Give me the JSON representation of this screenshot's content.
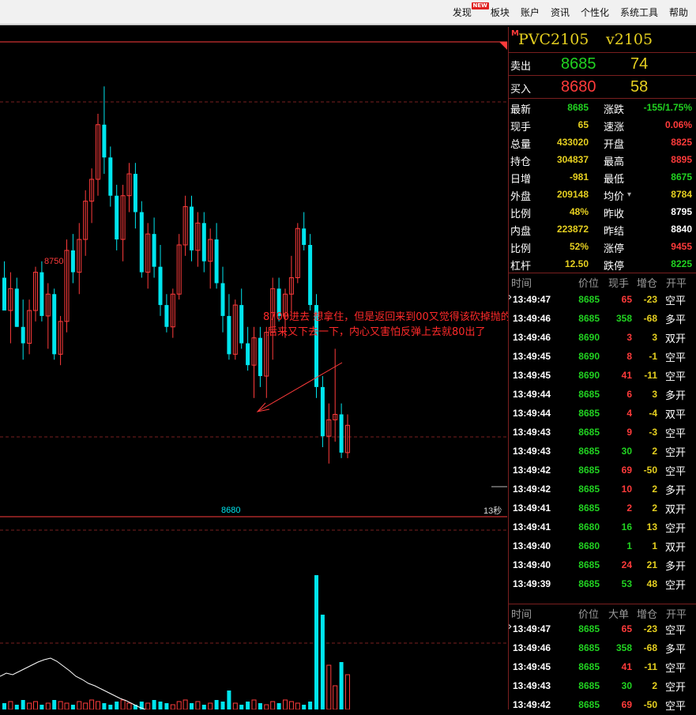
{
  "menu": [
    {
      "label": "发现",
      "badge": "NEW"
    },
    {
      "label": "板块"
    },
    {
      "label": "账户"
    },
    {
      "label": "资讯"
    },
    {
      "label": "个性化"
    },
    {
      "label": "系统工具"
    },
    {
      "label": "帮助"
    }
  ],
  "colors": {
    "up": "#ff3b3b",
    "down": "#00e5ee",
    "green": "#21d321",
    "yellow": "#e6d020",
    "white": "#ffffff",
    "grid": "#7a1f1f"
  },
  "chart": {
    "high_label": "8750",
    "low_label": "8680",
    "countdown": "13秒",
    "annotation_line1": "8700进去 想拿住，但是返回来到00又觉得该砍掉抛的",
    "annotation_line2": "后来又下去一下，内心又害怕反弹上去就80出了"
  },
  "header": {
    "marker": "M",
    "symbol": "PVC2105",
    "name": "v2105"
  },
  "order_book": {
    "ask": {
      "label": "卖出",
      "price": "8685",
      "volume": "74"
    },
    "bid": {
      "label": "买入",
      "price": "8680",
      "volume": "58"
    }
  },
  "quote_stats": [
    {
      "l1": "最新",
      "v1": "8685",
      "c1": "green",
      "l2": "涨跌",
      "v2": "-155/1.75%",
      "c2": "green"
    },
    {
      "l1": "现手",
      "v1": "65",
      "c1": "yellow",
      "l2": "速涨",
      "v2": "0.06%",
      "c2": "red"
    },
    {
      "l1": "总量",
      "v1": "433020",
      "c1": "yellow",
      "l2": "开盘",
      "v2": "8825",
      "c2": "red"
    },
    {
      "l1": "持仓",
      "v1": "304837",
      "c1": "yellow",
      "l2": "最高",
      "v2": "8895",
      "c2": "red"
    },
    {
      "l1": "日增",
      "v1": "-981",
      "c1": "yellow",
      "l2": "最低",
      "v2": "8675",
      "c2": "green"
    },
    {
      "l1": "外盘",
      "v1": "209148",
      "c1": "yellow",
      "l2": "均价",
      "v2": "8784",
      "c2": "yellow",
      "arrow": "▾"
    },
    {
      "l1": "比例",
      "v1": "48%",
      "c1": "yellow",
      "l2": "昨收",
      "v2": "8795",
      "c2": "white"
    },
    {
      "l1": "内盘",
      "v1": "223872",
      "c1": "yellow",
      "l2": "昨结",
      "v2": "8840",
      "c2": "white"
    },
    {
      "l1": "比例",
      "v1": "52%",
      "c1": "yellow",
      "l2": "涨停",
      "v2": "9455",
      "c2": "red"
    },
    {
      "l1": "杠杆",
      "v1": "12.50",
      "c1": "yellow",
      "l2": "跌停",
      "v2": "8225",
      "c2": "green"
    }
  ],
  "ticks": {
    "headers": [
      "时间",
      "价位",
      "现手",
      "增仓",
      "开平"
    ],
    "rows": [
      {
        "time": "13:49:47",
        "price": "8685",
        "vol": "65",
        "vc": "red",
        "chg": "-23",
        "type": "空平",
        "mark": true
      },
      {
        "time": "13:49:46",
        "price": "8685",
        "vol": "358",
        "vc": "green",
        "chg": "-68",
        "type": "多平"
      },
      {
        "time": "13:49:46",
        "price": "8690",
        "vol": "3",
        "vc": "red",
        "chg": "3",
        "type": "双开"
      },
      {
        "time": "13:49:45",
        "price": "8690",
        "vol": "8",
        "vc": "red",
        "chg": "-1",
        "type": "空平"
      },
      {
        "time": "13:49:45",
        "price": "8690",
        "vol": "41",
        "vc": "red",
        "chg": "-11",
        "type": "空平"
      },
      {
        "time": "13:49:44",
        "price": "8685",
        "vol": "6",
        "vc": "red",
        "chg": "3",
        "type": "多开"
      },
      {
        "time": "13:49:44",
        "price": "8685",
        "vol": "4",
        "vc": "red",
        "chg": "-4",
        "type": "双平"
      },
      {
        "time": "13:49:43",
        "price": "8685",
        "vol": "9",
        "vc": "red",
        "chg": "-3",
        "type": "空平"
      },
      {
        "time": "13:49:43",
        "price": "8685",
        "vol": "30",
        "vc": "green",
        "chg": "2",
        "type": "空开"
      },
      {
        "time": "13:49:42",
        "price": "8685",
        "vol": "69",
        "vc": "red",
        "chg": "-50",
        "type": "空平"
      },
      {
        "time": "13:49:42",
        "price": "8685",
        "vol": "10",
        "vc": "red",
        "chg": "2",
        "type": "多开"
      },
      {
        "time": "13:49:41",
        "price": "8685",
        "vol": "2",
        "vc": "red",
        "chg": "2",
        "type": "双开"
      },
      {
        "time": "13:49:41",
        "price": "8680",
        "vol": "16",
        "vc": "green",
        "chg": "13",
        "type": "空开"
      },
      {
        "time": "13:49:40",
        "price": "8680",
        "vol": "1",
        "vc": "green",
        "chg": "1",
        "type": "双开"
      },
      {
        "time": "13:49:40",
        "price": "8685",
        "vol": "24",
        "vc": "red",
        "chg": "21",
        "type": "多开"
      },
      {
        "time": "13:49:39",
        "price": "8685",
        "vol": "53",
        "vc": "green",
        "chg": "48",
        "type": "空开"
      }
    ]
  },
  "big_orders": {
    "headers": [
      "时间",
      "价位",
      "大单",
      "增仓",
      "开平"
    ],
    "rows": [
      {
        "time": "13:49:47",
        "price": "8685",
        "vol": "65",
        "vc": "red",
        "chg": "-23",
        "type": "空平",
        "mark": true
      },
      {
        "time": "13:49:46",
        "price": "8685",
        "vol": "358",
        "vc": "green",
        "chg": "-68",
        "type": "多平"
      },
      {
        "time": "13:49:45",
        "price": "8685",
        "vol": "41",
        "vc": "red",
        "chg": "-11",
        "type": "空平"
      },
      {
        "time": "13:49:43",
        "price": "8685",
        "vol": "30",
        "vc": "green",
        "chg": "2",
        "type": "空开"
      },
      {
        "time": "13:49:42",
        "price": "8685",
        "vol": "69",
        "vc": "red",
        "chg": "-50",
        "type": "空平"
      }
    ]
  },
  "chart_data": {
    "type": "candlestick",
    "title": "",
    "ylim": [
      8672,
      8758
    ],
    "labels": {
      "high": "8750",
      "low": "8680"
    },
    "candles": [
      {
        "o": 8715,
        "h": 8718,
        "l": 8709,
        "c": 8709
      },
      {
        "o": 8709,
        "h": 8716,
        "l": 8703,
        "c": 8713
      },
      {
        "o": 8713,
        "h": 8715,
        "l": 8706,
        "c": 8706
      },
      {
        "o": 8706,
        "h": 8711,
        "l": 8700,
        "c": 8703
      },
      {
        "o": 8703,
        "h": 8711,
        "l": 8701,
        "c": 8709
      },
      {
        "o": 8709,
        "h": 8717,
        "l": 8707,
        "c": 8716
      },
      {
        "o": 8716,
        "h": 8718,
        "l": 8707,
        "c": 8708
      },
      {
        "o": 8708,
        "h": 8714,
        "l": 8702,
        "c": 8712
      },
      {
        "o": 8712,
        "h": 8713,
        "l": 8700,
        "c": 8701
      },
      {
        "o": 8701,
        "h": 8708,
        "l": 8699,
        "c": 8707
      },
      {
        "o": 8707,
        "h": 8722,
        "l": 8705,
        "c": 8720
      },
      {
        "o": 8720,
        "h": 8723,
        "l": 8714,
        "c": 8716
      },
      {
        "o": 8716,
        "h": 8725,
        "l": 8712,
        "c": 8722
      },
      {
        "o": 8722,
        "h": 8731,
        "l": 8719,
        "c": 8729
      },
      {
        "o": 8729,
        "h": 8735,
        "l": 8725,
        "c": 8733
      },
      {
        "o": 8733,
        "h": 8745,
        "l": 8730,
        "c": 8743
      },
      {
        "o": 8743,
        "h": 8750,
        "l": 8734,
        "c": 8737
      },
      {
        "o": 8737,
        "h": 8739,
        "l": 8728,
        "c": 8730
      },
      {
        "o": 8730,
        "h": 8732,
        "l": 8720,
        "c": 8722
      },
      {
        "o": 8722,
        "h": 8732,
        "l": 8718,
        "c": 8730
      },
      {
        "o": 8730,
        "h": 8736,
        "l": 8727,
        "c": 8734
      },
      {
        "o": 8734,
        "h": 8736,
        "l": 8724,
        "c": 8727
      },
      {
        "o": 8727,
        "h": 8729,
        "l": 8715,
        "c": 8716
      },
      {
        "o": 8716,
        "h": 8725,
        "l": 8713,
        "c": 8723
      },
      {
        "o": 8723,
        "h": 8726,
        "l": 8715,
        "c": 8717
      },
      {
        "o": 8717,
        "h": 8721,
        "l": 8708,
        "c": 8710
      },
      {
        "o": 8710,
        "h": 8712,
        "l": 8705,
        "c": 8706
      },
      {
        "o": 8706,
        "h": 8713,
        "l": 8704,
        "c": 8712
      },
      {
        "o": 8712,
        "h": 8723,
        "l": 8711,
        "c": 8721
      },
      {
        "o": 8721,
        "h": 8730,
        "l": 8719,
        "c": 8728
      },
      {
        "o": 8728,
        "h": 8730,
        "l": 8718,
        "c": 8720
      },
      {
        "o": 8720,
        "h": 8727,
        "l": 8717,
        "c": 8725
      },
      {
        "o": 8725,
        "h": 8727,
        "l": 8716,
        "c": 8718
      },
      {
        "o": 8718,
        "h": 8724,
        "l": 8713,
        "c": 8722
      },
      {
        "o": 8722,
        "h": 8725,
        "l": 8713,
        "c": 8714
      },
      {
        "o": 8714,
        "h": 8717,
        "l": 8705,
        "c": 8708
      },
      {
        "o": 8708,
        "h": 8712,
        "l": 8700,
        "c": 8701
      },
      {
        "o": 8701,
        "h": 8711,
        "l": 8700,
        "c": 8710
      },
      {
        "o": 8710,
        "h": 8713,
        "l": 8702,
        "c": 8703
      },
      {
        "o": 8703,
        "h": 8706,
        "l": 8698,
        "c": 8699
      },
      {
        "o": 8699,
        "h": 8706,
        "l": 8693,
        "c": 8704
      },
      {
        "o": 8704,
        "h": 8706,
        "l": 8695,
        "c": 8697
      },
      {
        "o": 8697,
        "h": 8706,
        "l": 8693,
        "c": 8705
      },
      {
        "o": 8705,
        "h": 8715,
        "l": 8700,
        "c": 8713
      },
      {
        "o": 8713,
        "h": 8715,
        "l": 8707,
        "c": 8708
      },
      {
        "o": 8708,
        "h": 8713,
        "l": 8704,
        "c": 8712
      },
      {
        "o": 8712,
        "h": 8719,
        "l": 8708,
        "c": 8715
      },
      {
        "o": 8715,
        "h": 8725,
        "l": 8714,
        "c": 8724
      },
      {
        "o": 8724,
        "h": 8727,
        "l": 8720,
        "c": 8721
      },
      {
        "o": 8721,
        "h": 8723,
        "l": 8709,
        "c": 8710
      },
      {
        "o": 8710,
        "h": 8712,
        "l": 8693,
        "c": 8695
      },
      {
        "o": 8695,
        "h": 8697,
        "l": 8684,
        "c": 8686
      },
      {
        "o": 8686,
        "h": 8692,
        "l": 8681,
        "c": 8689
      },
      {
        "o": 8689,
        "h": 8702,
        "l": 8685,
        "c": 8690
      },
      {
        "o": 8690,
        "h": 8692,
        "l": 8682,
        "c": 8683
      },
      {
        "o": 8683,
        "h": 8690,
        "l": 8682,
        "c": 8688
      }
    ],
    "volume": [
      4,
      5,
      3,
      6,
      4,
      5,
      3,
      4,
      6,
      5,
      4,
      3,
      5,
      4,
      6,
      5,
      4,
      3,
      5,
      6,
      4,
      3,
      5,
      4,
      6,
      5,
      4,
      3,
      5,
      6,
      4,
      5,
      3,
      4,
      6,
      5,
      12,
      4,
      3,
      5,
      6,
      4,
      3,
      5,
      4,
      6,
      5,
      4,
      3,
      5,
      85,
      60,
      28,
      15,
      30,
      22
    ]
  }
}
